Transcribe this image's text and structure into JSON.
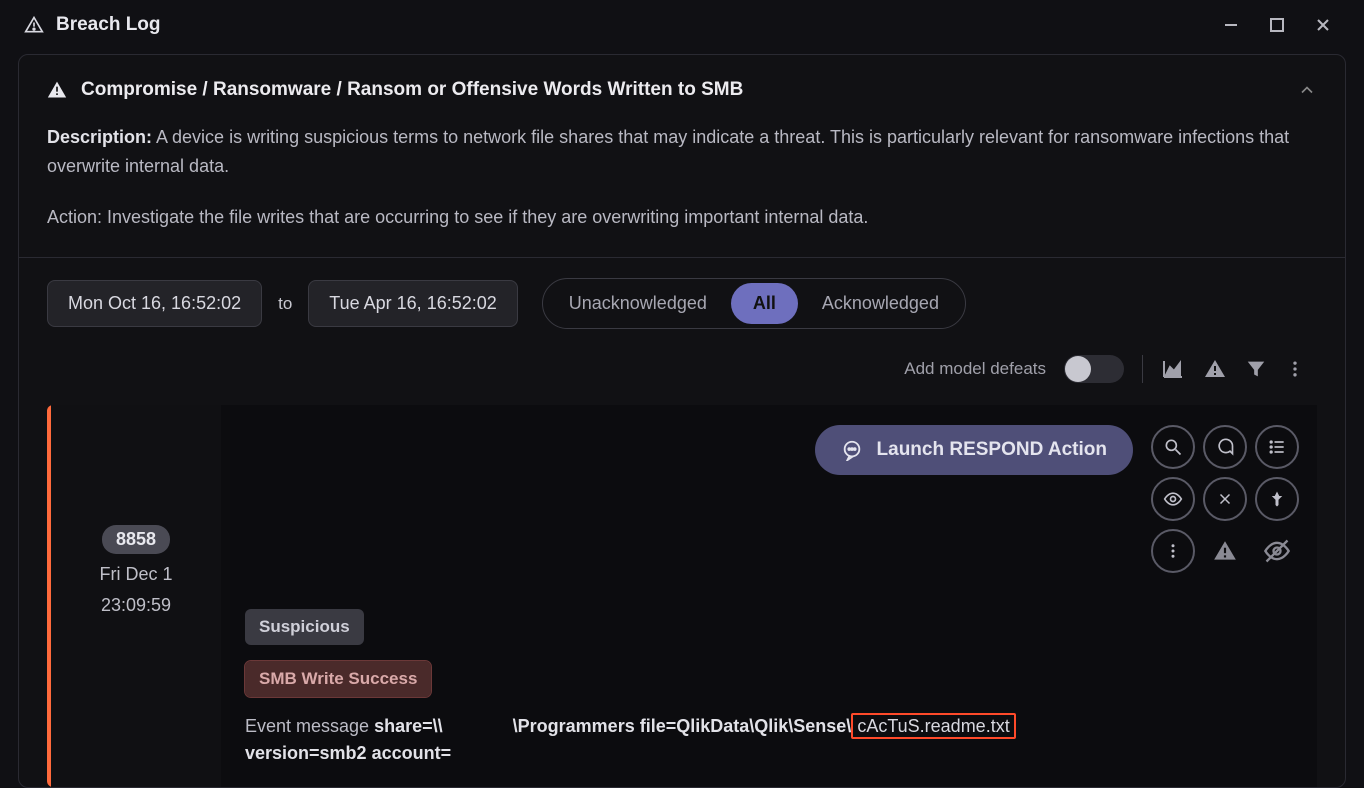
{
  "titlebar": {
    "title": "Breach Log"
  },
  "panel": {
    "heading": "Compromise / Ransomware / Ransom or Offensive Words Written to SMB",
    "desc_label": "Description:",
    "desc_text": " A device is writing suspicious terms to network file shares that may indicate a threat. This is particularly relevant for ransomware infections that overwrite internal data.",
    "action_text": "Action: Investigate the file writes that are occurring to see if they are overwriting important internal data."
  },
  "filters": {
    "date_from": "Mon Oct 16, 16:52:02",
    "to_label": "to",
    "date_to": "Tue Apr 16, 16:52:02",
    "seg_unack": "Unacknowledged",
    "seg_all": "All",
    "seg_ack": "Acknowledged"
  },
  "toolbar": {
    "defeats_label": "Add model defeats"
  },
  "event": {
    "count": "8858",
    "date": "Fri Dec 1",
    "time": "23:09:59",
    "respond_label": "Launch RESPOND Action",
    "tag_suspicious": "Suspicious",
    "tag_smb": "SMB Write Success",
    "msg_prefix": "Event message ",
    "msg_share_label": "share=\\\\",
    "msg_path": "\\Programmers file=QlikData\\Qlik\\Sense\\",
    "msg_highlight": "cAcTuS.readme.txt",
    "msg_line2a": "version=smb2 account=",
    "msg_line2b": ""
  }
}
